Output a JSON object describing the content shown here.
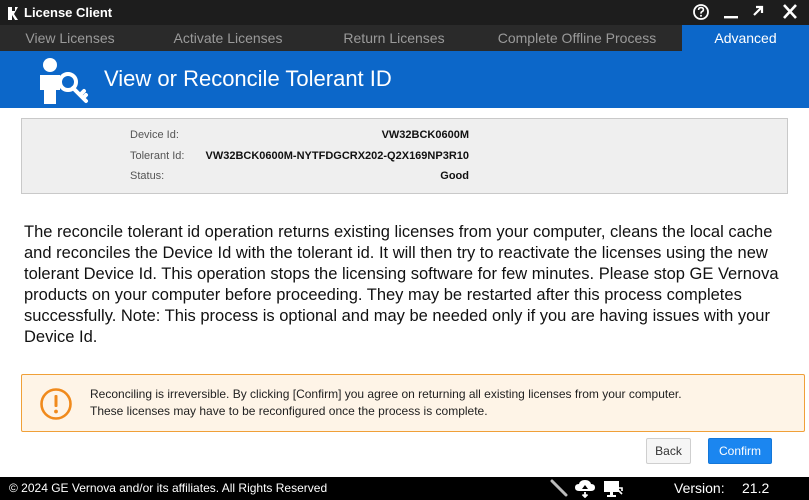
{
  "window": {
    "title": "License Client",
    "icons": [
      "app-logo-icon",
      "help-icon",
      "minimize-icon",
      "maximize-icon",
      "close-icon"
    ]
  },
  "tabs": [
    {
      "label": "View Licenses",
      "active": false
    },
    {
      "label": "Activate Licenses",
      "active": false
    },
    {
      "label": "Return Licenses",
      "active": false
    },
    {
      "label": "Complete Offline Process",
      "active": false
    },
    {
      "label": "Advanced",
      "active": true
    }
  ],
  "header": {
    "title": "View or Reconcile Tolerant ID",
    "icon": "user-key-icon"
  },
  "device_info": {
    "device_id_label": "Device Id:",
    "device_id_value": "VW32BCK0600M",
    "tolerant_id_label": "Tolerant Id:",
    "tolerant_id_value": "VW32BCK0600M-NYTFDGCRX202-Q2X169NP3R10",
    "status_label": "Status:",
    "status_value": "Good"
  },
  "description": "The reconcile tolerant id operation returns existing licenses from your computer, cleans the local cache and reconciles the Device Id with the tolerant id. It will then try to reactivate the licenses using the new tolerant Device Id. This operation stops the licensing software for few minutes. Please stop GE Vernova products on your computer before proceeding. They may be restarted after this process completes successfully. Note: This process is optional and may be needed only if you are having issues with your Device Id.",
  "warning": {
    "icon": "warning-circle-icon",
    "line1": "Reconciling is irreversible. By clicking [Confirm] you agree on returning all existing licenses from your computer.",
    "line2": "These licenses may have to be reconfigured once the process is complete."
  },
  "buttons": {
    "back": "Back",
    "confirm": "Confirm"
  },
  "statusbar": {
    "copyright": "© 2024 GE Vernova and/or its affiliates.  All Rights Reserved",
    "version_label": "Version:",
    "version_value": "21.2",
    "icons": [
      "pen-icon",
      "cloud-sync-icon",
      "monitor-icon"
    ]
  },
  "colors": {
    "accent": "#0c67c9",
    "confirm": "#1b86f0",
    "warning_border": "#f0a038",
    "titlebar": "#1d1d1d"
  }
}
